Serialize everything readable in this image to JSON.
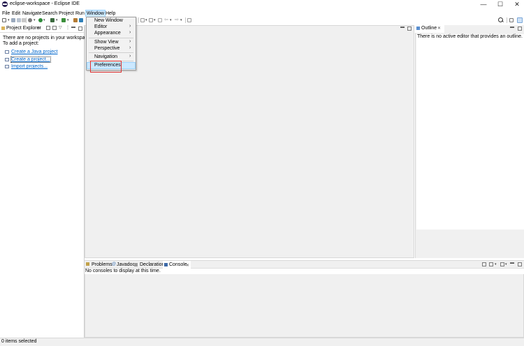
{
  "window": {
    "title": "eclipse-workspace - Eclipse IDE",
    "minimize": "—",
    "maximize": "☐",
    "close": "✕"
  },
  "menubar": {
    "items": [
      "File",
      "Edit",
      "Navigate",
      "Search",
      "Project",
      "Run",
      "Window",
      "Help"
    ]
  },
  "window_menu": {
    "items": [
      {
        "label": "New Window"
      },
      {
        "label": "Editor",
        "arrow": "›"
      },
      {
        "label": "Appearance",
        "arrow": "›"
      },
      {
        "label": "Show View",
        "arrow": "›"
      },
      {
        "label": "Perspective",
        "arrow": "›"
      },
      {
        "label": "Navigation",
        "arrow": "›"
      },
      {
        "label": "Preferences"
      }
    ]
  },
  "project_explorer": {
    "tab_label": "Project Explorer",
    "close": "✕",
    "message_line1": "There are no projects in your workspace.",
    "message_line2": "To add a project:",
    "links": [
      "Create a Java project",
      "Create a project...",
      "Import projects..."
    ]
  },
  "outline": {
    "tab_label": "Outline",
    "close": "✕",
    "message": "There is no active editor that provides an outline."
  },
  "bottom_tabs": {
    "problems": "Problems",
    "javadoc": "Javadoc",
    "declaration": "Declaration",
    "console": "Console",
    "close": "✕",
    "message": "No consoles to display at this time."
  },
  "status": {
    "text": "0 items selected"
  },
  "colors": {
    "accent_menu_hl": "#cce8ff",
    "highlight_box": "#e03030",
    "link": "#0066cc"
  }
}
